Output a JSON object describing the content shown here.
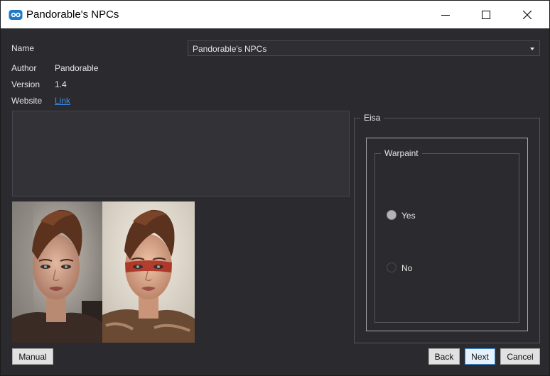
{
  "window": {
    "title": "Pandorable's NPCs"
  },
  "fields": {
    "name_label": "Name",
    "name_value": "Pandorable's NPCs",
    "author_label": "Author",
    "author_value": "Pandorable",
    "version_label": "Version",
    "version_value": "1.4",
    "website_label": "Website",
    "website_link": "Link"
  },
  "options": {
    "group_title": "Eisa",
    "subgroup_title": "Warpaint",
    "choices": [
      {
        "label": "Yes",
        "selected": true
      },
      {
        "label": "No",
        "selected": false
      }
    ]
  },
  "buttons": {
    "manual": "Manual",
    "back": "Back",
    "next": "Next",
    "cancel": "Cancel"
  },
  "colors": {
    "background": "#2b2b2f",
    "titlebar": "#ffffff",
    "link": "#3a8ef0",
    "focus_border": "#3d8fe0"
  }
}
